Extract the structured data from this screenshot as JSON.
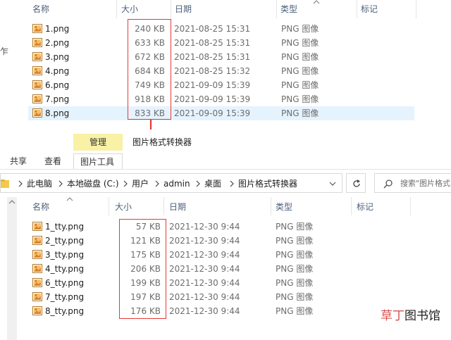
{
  "top": {
    "headers": {
      "name": "名称",
      "size": "大小",
      "date": "日期",
      "type": "类型",
      "tags": "标记"
    },
    "rows": [
      {
        "name": "1.png",
        "size": "240 KB",
        "date": "2021-08-25 15:31",
        "type": "PNG 图像"
      },
      {
        "name": "2.png",
        "size": "633 KB",
        "date": "2021-08-25 15:31",
        "type": "PNG 图像"
      },
      {
        "name": "3.png",
        "size": "672 KB",
        "date": "2021-08-25 15:31",
        "type": "PNG 图像"
      },
      {
        "name": "4.png",
        "size": "684 KB",
        "date": "2021-08-25 15:32",
        "type": "PNG 图像"
      },
      {
        "name": "6.png",
        "size": "749 KB",
        "date": "2021-09-09 15:39",
        "type": "PNG 图像"
      },
      {
        "name": "7.png",
        "size": "918 KB",
        "date": "2021-09-09 15:39",
        "type": "PNG 图像"
      },
      {
        "name": "8.png",
        "size": "833 KB",
        "date": "2021-09-09 15:39",
        "type": "PNG 图像"
      }
    ],
    "sidebar_glyph": "乍"
  },
  "bottom": {
    "ribbon": {
      "context_tab": "管理",
      "tabs": [
        "共享",
        "查看",
        "图片工具"
      ],
      "window_title": "图片格式转换器"
    },
    "address": {
      "crumbs": [
        "此电脑",
        "本地磁盘 (C:)",
        "用户",
        "admin",
        "桌面",
        "图片格式转换器"
      ],
      "search_placeholder": "搜索\"图片格式"
    },
    "headers": {
      "name": "名称",
      "size": "大小",
      "date": "日期",
      "type": "类型",
      "tags": "标记"
    },
    "rows": [
      {
        "name": "1_tty.png",
        "size": "57 KB",
        "date": "2021-12-30 9:44",
        "type": "PNG 图像"
      },
      {
        "name": "2_tty.png",
        "size": "121 KB",
        "date": "2021-12-30 9:44",
        "type": "PNG 图像"
      },
      {
        "name": "3_tty.png",
        "size": "175 KB",
        "date": "2021-12-30 9:44",
        "type": "PNG 图像"
      },
      {
        "name": "4_tty.png",
        "size": "206 KB",
        "date": "2021-12-30 9:44",
        "type": "PNG 图像"
      },
      {
        "name": "6_tty.png",
        "size": "199 KB",
        "date": "2021-12-30 9:44",
        "type": "PNG 图像"
      },
      {
        "name": "7_tty.png",
        "size": "197 KB",
        "date": "2021-12-30 9:44",
        "type": "PNG 图像"
      },
      {
        "name": "8_tty.png",
        "size": "176 KB",
        "date": "2021-12-30 9:44",
        "type": "PNG 图像"
      }
    ]
  },
  "watermark": {
    "accent": "草丁",
    "rest": "图书馆"
  },
  "colors": {
    "highlight": "#e53935",
    "selected_row": "#e5f3ff",
    "context_tab": "#f9f1a5"
  },
  "icons": {
    "file": "png-image-icon",
    "arrow": "down-arrow-icon"
  }
}
